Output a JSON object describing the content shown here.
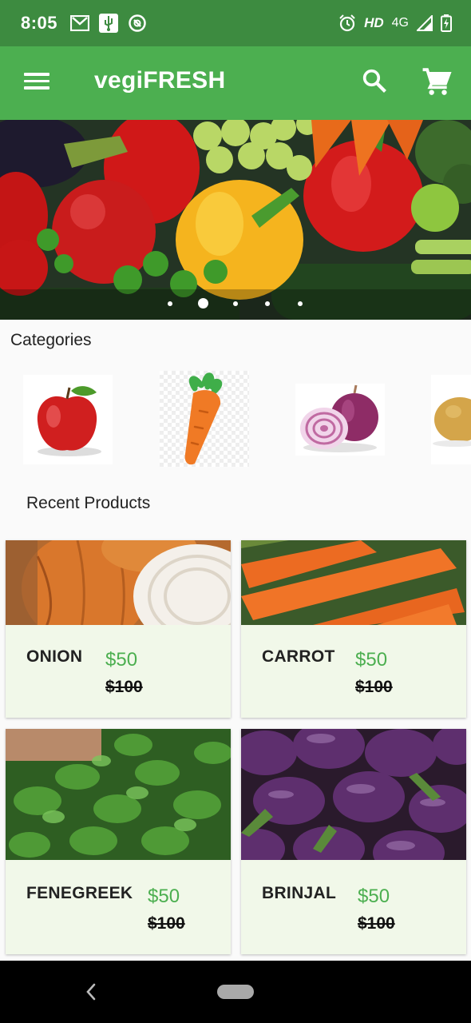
{
  "status_bar": {
    "time": "8:05",
    "left_icons": [
      "gmail-icon",
      "usb-icon",
      "data-saver-icon"
    ],
    "right_text_hd": "HD",
    "right_text_network": "4G",
    "right_icons": [
      "alarm-icon",
      "signal-icon",
      "battery-charging-icon"
    ]
  },
  "app_bar": {
    "title": "vegiFRESH",
    "color": "#4caf50",
    "status_color": "#3d8b40",
    "icons": [
      "menu-icon",
      "search-icon",
      "cart-icon"
    ]
  },
  "banner": {
    "description_icon": "vegetables-banner-image",
    "slide_count": 5,
    "active_slide": 2
  },
  "categories": {
    "heading": "Categories",
    "items": [
      {
        "icon": "apple-icon"
      },
      {
        "icon": "carrot-icon"
      },
      {
        "icon": "onion-icon"
      },
      {
        "icon": "potato-icon"
      }
    ]
  },
  "recent": {
    "heading": "Recent Products",
    "products": [
      {
        "name": "ONION",
        "price": "$50",
        "old_price": "$100"
      },
      {
        "name": "CARROT",
        "price": "$50",
        "old_price": "$100"
      },
      {
        "name": "FENEGREEK",
        "price": "$50",
        "old_price": "$100"
      },
      {
        "name": "BRINJAL",
        "price": "$50",
        "old_price": "$100"
      }
    ]
  },
  "nav_bar": {
    "icons": [
      "back-icon",
      "home-pill-icon"
    ]
  }
}
